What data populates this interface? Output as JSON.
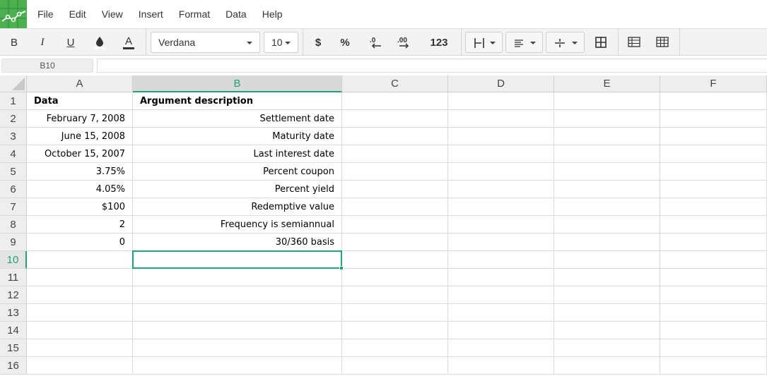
{
  "menu": [
    "File",
    "Edit",
    "View",
    "Insert",
    "Format",
    "Data",
    "Help"
  ],
  "toolbar": {
    "bold": "B",
    "italic": "I",
    "underline": "U",
    "font_name": "Verdana",
    "font_size": "10",
    "currency": "$",
    "percent": "%",
    "decrease_decimals": ".0",
    "increase_decimals": ".00",
    "number_format": "123"
  },
  "namebox": "B10",
  "formula": "",
  "columns": [
    "A",
    "B",
    "C",
    "D",
    "E",
    "F"
  ],
  "rows": [
    "1",
    "2",
    "3",
    "4",
    "5",
    "6",
    "7",
    "8",
    "9",
    "10",
    "11",
    "12",
    "13",
    "14",
    "15",
    "16"
  ],
  "cells": {
    "A1": "Data",
    "B1": "Argument description",
    "A2": "February 7, 2008",
    "B2": "Settlement date",
    "A3": "June 15, 2008",
    "B3": "Maturity date",
    "A4": "October 15, 2007",
    "B4": "Last interest date",
    "A5": "3.75%",
    "B5": "Percent coupon",
    "A6": "4.05%",
    "B6": "Percent yield",
    "A7": "$100",
    "B7": "Redemptive value",
    "A8": "2",
    "B8": "Frequency is semiannual",
    "A9": "0",
    "B9": "30/360 basis"
  },
  "selected_cell": "B10",
  "colors": {
    "accent": "#22a17a",
    "logo": "#4caf50"
  }
}
